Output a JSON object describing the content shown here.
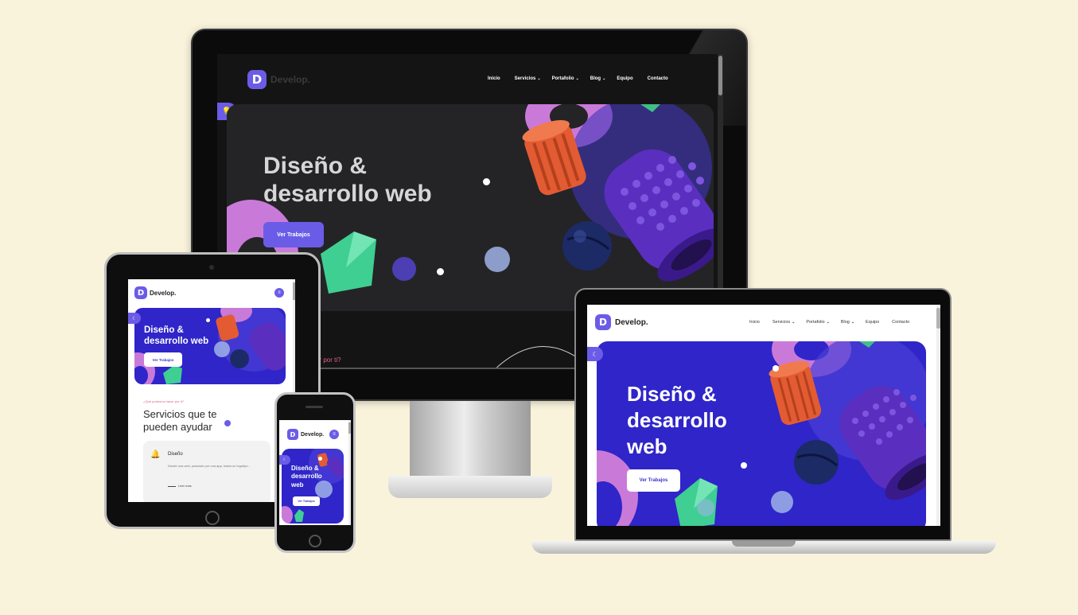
{
  "brand": {
    "letter": "D",
    "name": "Develop."
  },
  "nav": {
    "items": [
      "Inicio",
      "Servicios",
      "Portafolio",
      "Blog",
      "Equipo",
      "Contacto"
    ],
    "has_dropdown": [
      false,
      true,
      true,
      true,
      false,
      false
    ]
  },
  "hero": {
    "title_line1": "Diseño &",
    "title_line2": "desarrollo web",
    "cta_label": "Ver Trabajos"
  },
  "hero_laptop": {
    "title_line1": "Diseño &",
    "title_line2": "desarrollo",
    "title_line3": "web"
  },
  "hero_phone": {
    "title_line1": "Diseño &",
    "title_line2": "desarrollo",
    "title_line3": "web"
  },
  "services": {
    "eyebrow": "¿Qué podemos hacer por ti?",
    "eyebrow_partial": "er por ti?",
    "heading_line1": "Servicios que te",
    "heading_line2": "pueden ayudar",
    "card": {
      "title": "Diseño",
      "body": "Desde una web, pasando por una app, hasta un logotipo...",
      "link": "Leer mas"
    }
  },
  "colors": {
    "page_bg": "#faf3dc",
    "accent": "#6b5ce7",
    "hero_blue": "#2f25c9",
    "dark_bg": "#141414",
    "eyebrow_pink": "#e0608a"
  },
  "icons": {
    "dropdown": "chevron-down-icon",
    "side_tab_dark": "bulb-icon",
    "side_tab_light": "moon-icon",
    "menu": "hamburger-menu-icon",
    "card": "bell-icon"
  }
}
